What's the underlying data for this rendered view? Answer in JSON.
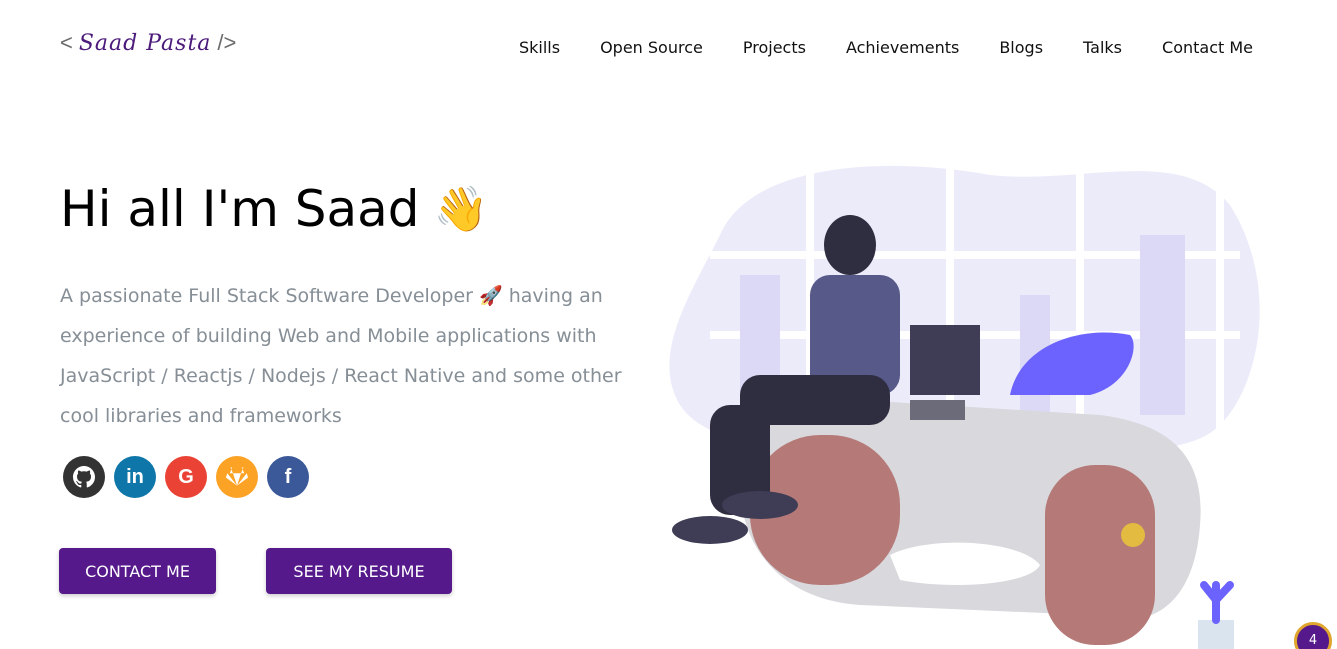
{
  "header": {
    "logo": {
      "open": "<",
      "signature": "Saad Pasta",
      "close": "/>"
    },
    "nav": [
      {
        "label": "Skills"
      },
      {
        "label": "Open Source"
      },
      {
        "label": "Projects"
      },
      {
        "label": "Achievements"
      },
      {
        "label": "Blogs"
      },
      {
        "label": "Talks"
      },
      {
        "label": "Contact Me"
      }
    ]
  },
  "hero": {
    "title": "Hi all I'm Saad",
    "wave_emoji": "👋",
    "subtitle": "A passionate Full Stack Software Developer 🚀 having an experience of building Web and Mobile applications with JavaScript / Reactjs / Nodejs / React Native and some other cool libraries and frameworks",
    "socials": [
      {
        "icon": "github-icon",
        "glyph": "",
        "color": "#333333"
      },
      {
        "icon": "linkedin-icon",
        "glyph": "in",
        "color": "#0e76a8"
      },
      {
        "icon": "google-icon",
        "glyph": "G",
        "color": "#ea4335"
      },
      {
        "icon": "gitlab-icon",
        "glyph": "",
        "color": "#fca326"
      },
      {
        "icon": "facebook-icon",
        "glyph": "f",
        "color": "#3b5998"
      }
    ],
    "buttons": {
      "contact": "CONTACT ME",
      "resume": "SEE MY RESUME"
    }
  },
  "colors": {
    "primary": "#55198b",
    "subtitle": "#868e96"
  },
  "badge": {
    "count": "4"
  }
}
